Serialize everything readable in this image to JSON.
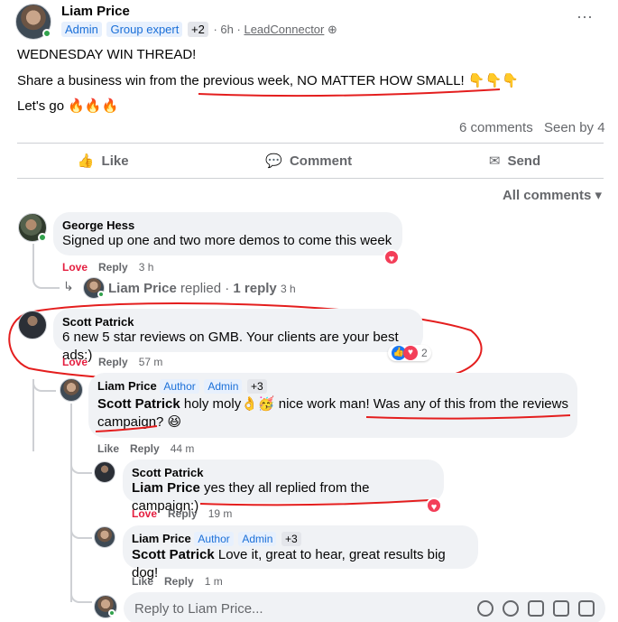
{
  "post": {
    "author": "Liam Price",
    "badges": [
      "Admin",
      "Group expert"
    ],
    "badge_more": "+2",
    "time": "6h",
    "via": "LeadConnector",
    "line1": "WEDNESDAY WIN THREAD!",
    "line2_a": "Share a business win from the ",
    "line2_b": "previous week, NO MATTER HOW SMALL!",
    "line2_emoji": "👇👇👇",
    "line3": "Let's go 🔥🔥🔥",
    "comments_count": "6 comments",
    "seen_by": "Seen by 4",
    "menu": "···"
  },
  "actions": {
    "like": "Like",
    "comment": "Comment",
    "send": "Send"
  },
  "sort_label": "All comments",
  "comments": {
    "c1": {
      "name": "George Hess",
      "text": "Signed up one and two more demos to come this week",
      "love": "Love",
      "reply": "Reply",
      "time": "3 h"
    },
    "c1_replies": {
      "name": "Liam Price",
      "label": " replied · ",
      "count": "1 reply",
      "time": "3 h"
    },
    "c2": {
      "name": "Scott Patrick",
      "text": "6 new 5 star reviews on GMB. Your clients are your best ads:)",
      "love": "Love",
      "reply": "Reply",
      "time": "57 m",
      "reactions": "2"
    },
    "r1": {
      "name": "Liam Price",
      "badge1": "Author",
      "badge2": "Admin",
      "more": "+3",
      "mention": "Scott Patrick",
      "text_a": " holy moly👌🥳 nice work man! ",
      "text_b": "Was any of this from the reviews campaign?",
      "emoji": " 😆",
      "like": "Like",
      "reply": "Reply",
      "time": "44 m"
    },
    "r2": {
      "name": "Scott Patrick",
      "mention": "Liam Price",
      "text": " yes they all replied from the campaign:)",
      "love": "Love",
      "reply": "Reply",
      "time": "19 m"
    },
    "r3": {
      "name": "Liam Price",
      "badge1": "Author",
      "badge2": "Admin",
      "more": "+3",
      "mention": "Scott Patrick",
      "text": " Love it, great to hear, great results big dog!",
      "like": "Like",
      "reply": "Reply",
      "time": "1 m"
    }
  },
  "reply_box": {
    "placeholder": "Reply to Liam Price..."
  }
}
